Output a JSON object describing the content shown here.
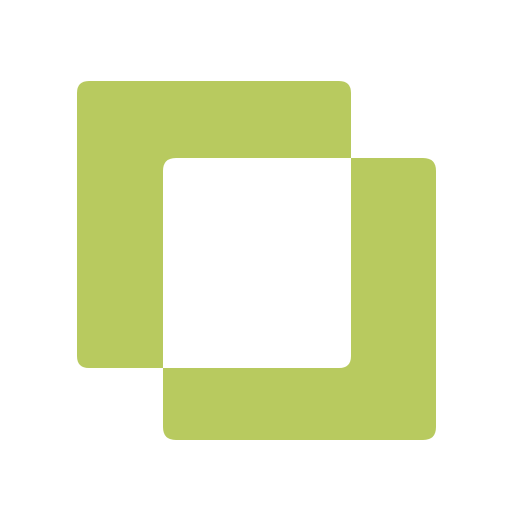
{
  "icon": {
    "name": "overlapping-squares-icon",
    "shape_color": "#b8ca5f",
    "background_color": "#ffffff"
  }
}
